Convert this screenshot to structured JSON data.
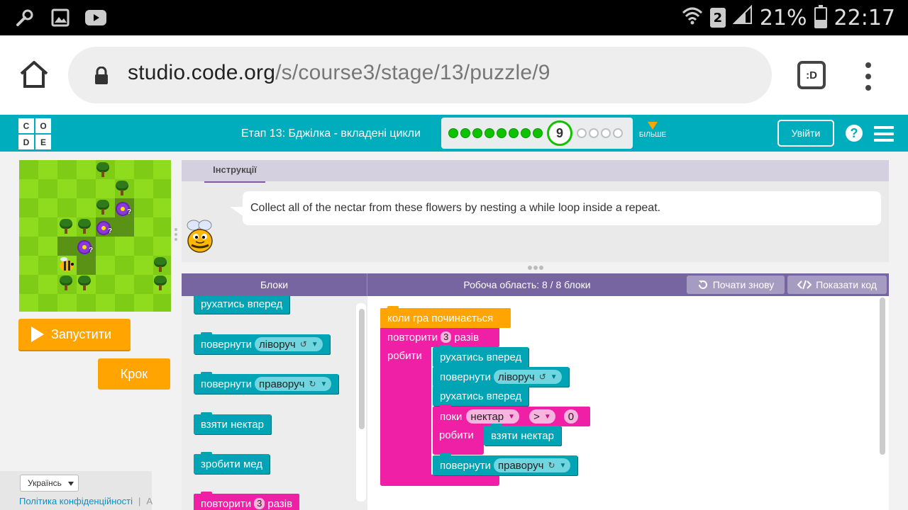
{
  "status_bar": {
    "battery": "21%",
    "time": "22:17",
    "sim": "2"
  },
  "browser": {
    "url_host": "studio.code.org",
    "url_path": "/s/course3/stage/13/puzzle/9",
    "tabs_label": ":D"
  },
  "header": {
    "logo_letters": [
      "C",
      "O",
      "D",
      "E"
    ],
    "stage_title": "Етап 13: Бджілка - вкладені цикли",
    "current_puzzle": "9",
    "completed_dots": 8,
    "remaining_dots": 4,
    "more_label": "БІЛЬШЕ",
    "signin_label": "Увійти",
    "help_label": "?"
  },
  "controls": {
    "run_label": "Запустити",
    "step_label": "Крок"
  },
  "footer": {
    "language": "Українсь",
    "privacy": "Політика конфіденційності",
    "sep": "|",
    "trail": "А"
  },
  "instructions": {
    "tab_label": "Інструкції",
    "text": "Collect all of the nectar from these flowers by nesting a while loop inside a repeat."
  },
  "workspace_header": {
    "blocks_label": "Блоки",
    "title": "Робоча область: 8 / 8 блоки",
    "reset_label": "Почати знову",
    "show_code_label": "Показати код"
  },
  "toolbox": {
    "move_forward": "рухатись вперед",
    "turn": "повернути",
    "left": "ліворуч",
    "right": "праворуч",
    "get_nectar": "взяти нектар",
    "make_honey": "зробити мед",
    "repeat": "повторити",
    "repeat_count": "3",
    "times": "разів"
  },
  "program": {
    "when_run": "коли гра починається",
    "repeat": "повторити",
    "repeat_count": "3",
    "times": "разів",
    "do": "робити",
    "move_forward": "рухатись вперед",
    "turn": "повернути",
    "left": "ліворуч",
    "right": "праворуч",
    "while": "поки",
    "nectar": "нектар",
    "op": ">",
    "zero": "0",
    "get_nectar": "взяти нектар"
  },
  "colors": {
    "code_teal": "#00adbc",
    "run_orange": "#ffa400",
    "block_teal": "#00a4b4",
    "block_pink": "#f020a6",
    "event_orange": "#ffa400",
    "header_purple": "#7665a0"
  }
}
